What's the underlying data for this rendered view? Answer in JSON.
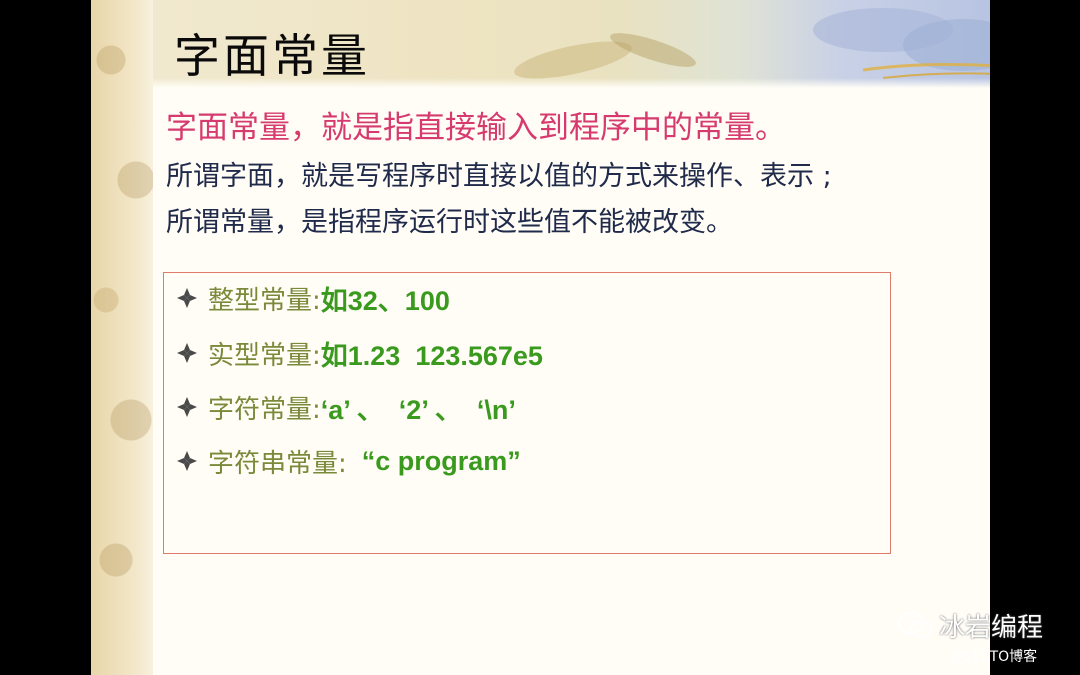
{
  "slide": {
    "title": "字面常量",
    "intro_red": "字面常量，就是指直接输入到程序中的常量。",
    "intro_lines": [
      "所谓字面，就是写程序时直接以值的方式来操作、表示 ;",
      "所谓常量，是指程序运行时这些值不能被改变。"
    ],
    "items": [
      {
        "label": "整型常量:",
        "value": "如32、100"
      },
      {
        "label": "实型常量:",
        "value": "如1.23  123.567e5"
      },
      {
        "label": "字符常量:",
        "value": "‘a’ 、  ‘2’ 、  ‘\\n’"
      },
      {
        "label": "字符串常量:",
        "value": "  “c program”"
      }
    ]
  },
  "watermark": {
    "brand": "冰岩编程",
    "credit": "@51CTO博客",
    "icon": "wechat-icon"
  },
  "colors": {
    "title": "#0a0a0a",
    "intro_red": "#d63a6e",
    "intro_text": "#202a4a",
    "label": "#7b8a3a",
    "value": "#3a9a1e",
    "box_border": "#e07a6a"
  }
}
